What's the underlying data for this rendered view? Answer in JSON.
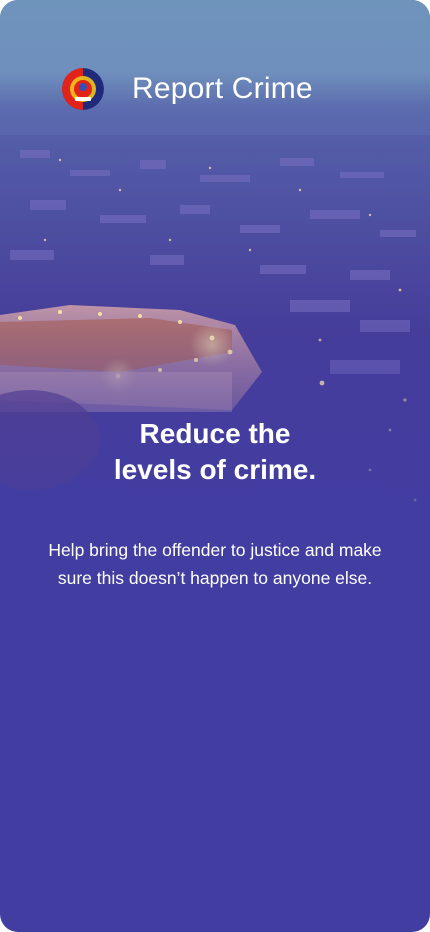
{
  "header": {
    "title": "Report Crime",
    "logo_icon": "police-emblem-icon"
  },
  "hero": {
    "headline_line1": "Reduce the",
    "headline_line2": "levels of crime.",
    "description": "Help bring the offender to justice and make sure this doesn’t happen to anyone else."
  },
  "colors": {
    "background": "#423da1",
    "sky": "#6f94bc",
    "text": "#ffffff"
  }
}
